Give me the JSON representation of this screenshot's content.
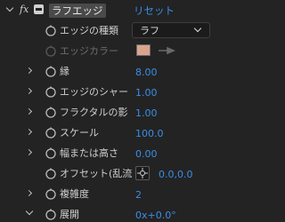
{
  "effect": {
    "title": "ラフエッジ",
    "fx_label": "fx",
    "reset_label": "リセット"
  },
  "properties": {
    "edge_type": {
      "label": "エッジの種類",
      "value": "ラフ"
    },
    "edge_color": {
      "label": "エッジカラー",
      "color": "#d8a58c"
    },
    "border": {
      "label": "縁",
      "value": "8.00"
    },
    "edge_sharpness": {
      "label": "エッジのシャー",
      "value": "1.00"
    },
    "fractal_influence": {
      "label": "フラクタルの影",
      "value": "1.00"
    },
    "scale": {
      "label": "スケール",
      "value": "100.0"
    },
    "stretch_width_height": {
      "label": "幅または高さ",
      "value": "0.00"
    },
    "offset_turbulence": {
      "label": "オフセット(乱流",
      "value": "0.0,0.0"
    },
    "complexity": {
      "label": "複雑度",
      "value": "2"
    },
    "evolution": {
      "label": "展開",
      "value": "0x+0.0°"
    }
  },
  "colors": {
    "value_blue": "#3a8ee6",
    "background": "#232323"
  }
}
